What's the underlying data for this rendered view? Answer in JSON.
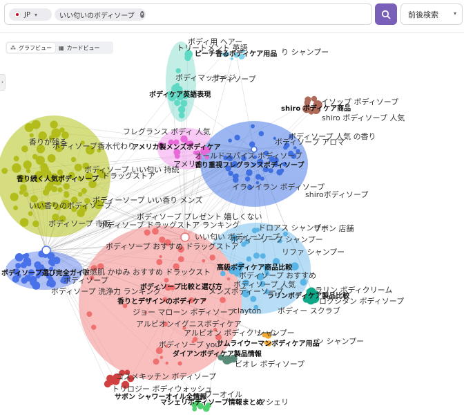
{
  "search": {
    "country_chip": "JP",
    "keyword_chip": "いい匂いのボディソープ",
    "dropdown_label": "前後検索"
  },
  "view_toggle": {
    "graph_label": "グラフビュー",
    "card_label": "カードビュー",
    "active": "graph"
  },
  "clusters": [
    {
      "name": "ピーチ香るボディケア用品",
      "color": "#7fd4f0"
    },
    {
      "name": "ボディケア英語表現",
      "color": "#5fd8c4"
    },
    {
      "name": "shiro ボディケア商品",
      "color": "#b06a5a"
    },
    {
      "name": "アメリカ製メンズボディケア",
      "color": "#e86ad8"
    },
    {
      "name": "香り重視フレグランスボディソープ",
      "color": "#3f6fe0"
    },
    {
      "name": "香り続く人気ボディソープ",
      "color": "#b2bd1c"
    },
    {
      "name": "ボディソープ選び完全ガイド",
      "color": "#4a72e8"
    },
    {
      "name": "高級ボディケア商品比較",
      "color": "#5ab4e6"
    },
    {
      "name": "ボディソープ比較と選び方",
      "color": "#f07070"
    },
    {
      "name": "香りとデザインのボディケア",
      "color": "#f07070"
    },
    {
      "name": "ラリンボディケア製品比較",
      "color": "#0fa888"
    },
    {
      "name": "サムライウーマンボディケア用品",
      "color": "#f0a830"
    },
    {
      "name": "ダイアンボディケア製品情報",
      "color": "#5a8a78"
    },
    {
      "name": "サボン シャワーオイル全情報",
      "color": "#d04040"
    },
    {
      "name": "マシェリボディソープ情報まとめ",
      "color": "#50d070"
    }
  ],
  "nodes": [
    {
      "label": "トリートメント 英語"
    },
    {
      "label": "ボディ用 ヘアー"
    },
    {
      "label": "ボディマッサージ"
    },
    {
      "label": "ボディソープ"
    },
    {
      "label": "り シャンプー"
    },
    {
      "label": "イソップ ボディソープ"
    },
    {
      "label": "shiro ボディソープ 人気"
    },
    {
      "label": "ボディソープ 人気 の香り"
    },
    {
      "label": "ボディソープ アロマ"
    },
    {
      "label": "フレグランス ボディ 人気"
    },
    {
      "label": "香水代わり"
    },
    {
      "label": "オールドスパイス ボディソープ"
    },
    {
      "label": "アメリカ"
    },
    {
      "label": "香りが残る"
    },
    {
      "label": "ボディソープ"
    },
    {
      "label": "ボディソープ いい匂い 持続"
    },
    {
      "label": "ドラッグストア"
    },
    {
      "label": "ボディーソープ いい香り メンズ"
    },
    {
      "label": "いい香りのボディソープ"
    },
    {
      "label": "ボディソープ 市販"
    },
    {
      "label": "イランイラン ボディソープ"
    },
    {
      "label": "shiroボディソープ"
    },
    {
      "label": "ボディソープ プレゼント 嬉しくない"
    },
    {
      "label": "ボディソープ ドラッグストア ランキング"
    },
    {
      "label": "ドロアス シャンプー"
    },
    {
      "label": "サボン 店舗"
    },
    {
      "label": "いい匂い ボディーソープ"
    },
    {
      "label": "ボディーソープ シャンプー"
    },
    {
      "label": "ボディソープ おすすめ ドラッグストア"
    },
    {
      "label": "リファ シャンプー"
    },
    {
      "label": "敏感肌 かゆみ おすすめ ドラックスト"
    },
    {
      "label": "ボディソープ"
    },
    {
      "label": "ボディソープ おすすめ"
    },
    {
      "label": "ラリン ボディクリーム"
    },
    {
      "label": "ボディソープ 洗浄力 ランキング"
    },
    {
      "label": "ボディソープ 人気"
    },
    {
      "label": "メンズボディーソープ"
    },
    {
      "label": "ロクシタン ボディソープ"
    },
    {
      "label": "ジョー マローン ボディソープ"
    },
    {
      "label": "clayton"
    },
    {
      "label": "ボディー スクラブ"
    },
    {
      "label": "アルビオンイグニスボディケア"
    },
    {
      "label": "アルビオン ボディクリーム"
    },
    {
      "label": "シャンプー"
    },
    {
      "label": "ボディソープ you"
    },
    {
      "label": "ン シャンプー"
    },
    {
      "label": "ビオレ ボディソープ"
    },
    {
      "label": "コスメキッチン ボディソープ"
    },
    {
      "label": "トリロジー ボディウォッシュ"
    },
    {
      "label": "ワーオイル"
    },
    {
      "label": "マシェリ"
    }
  ]
}
